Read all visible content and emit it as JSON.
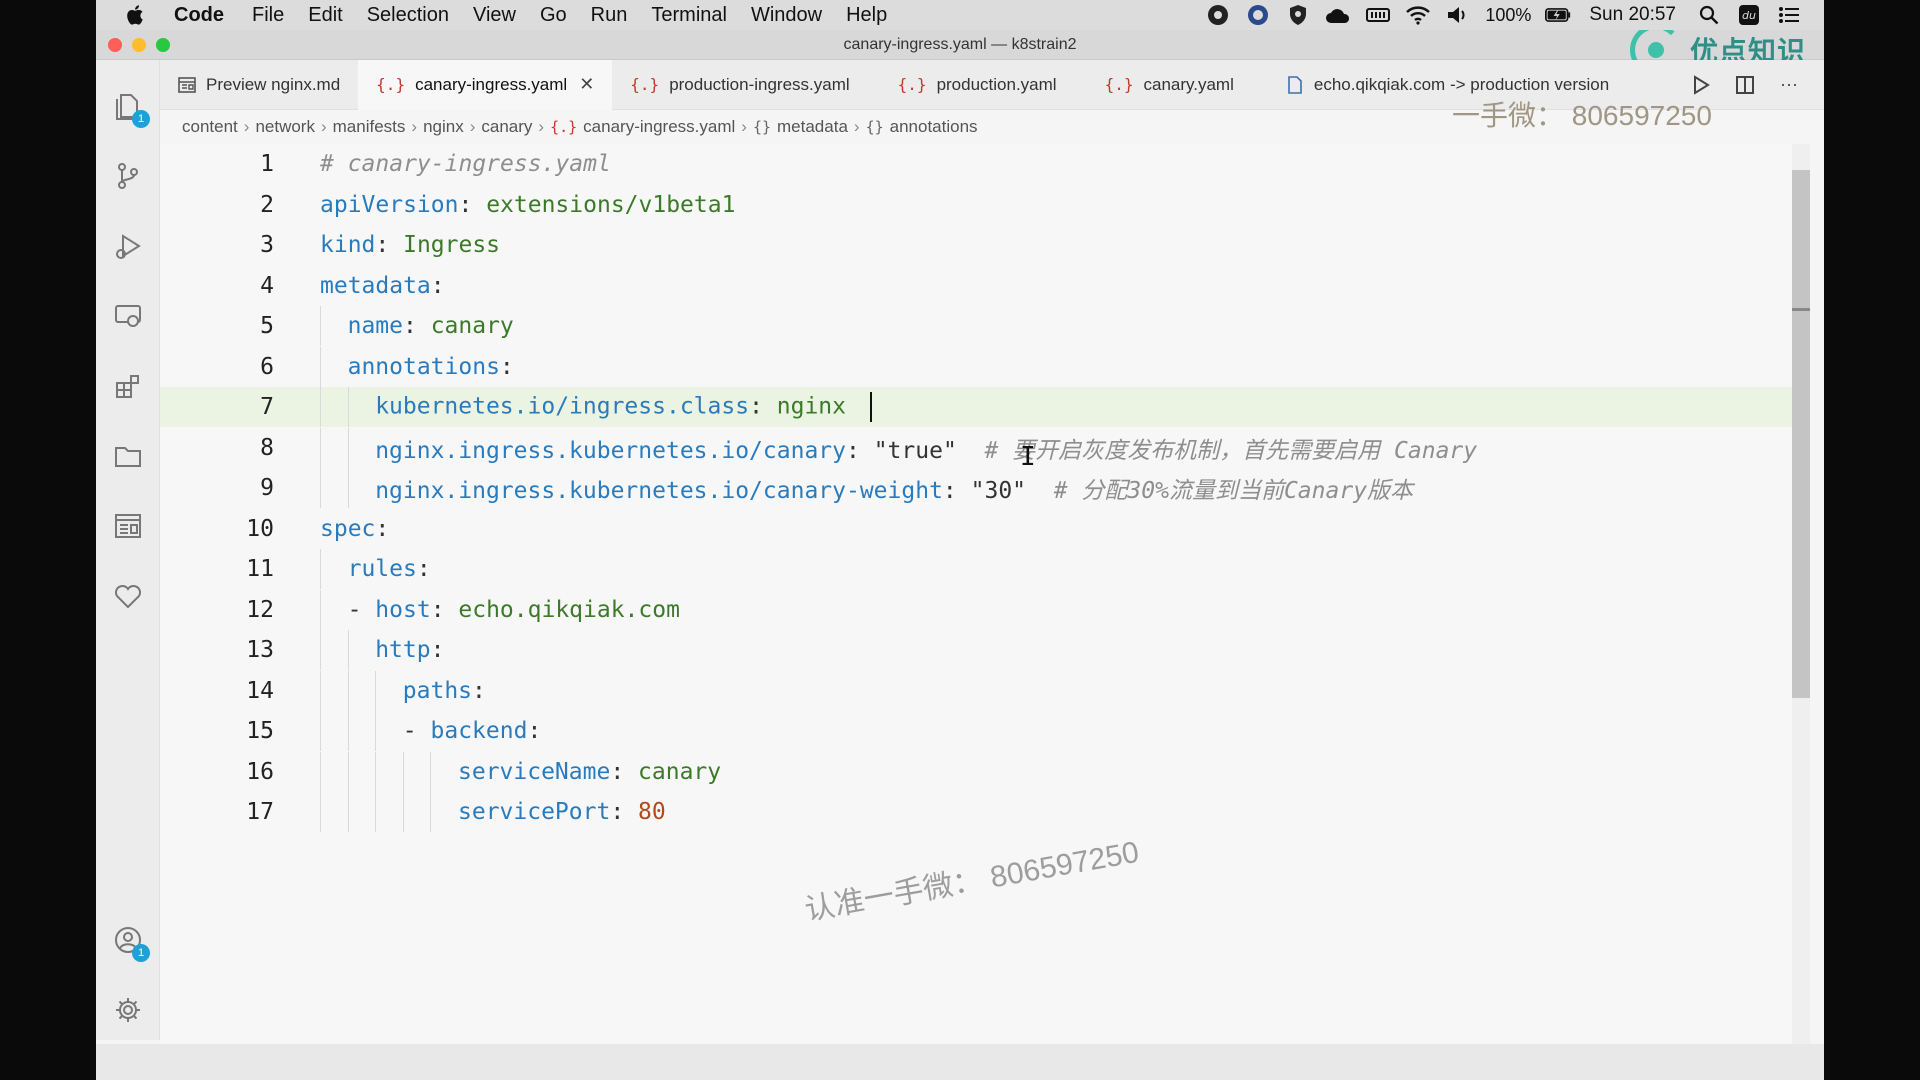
{
  "menubar": {
    "app_name": "Code",
    "items": [
      "File",
      "Edit",
      "Selection",
      "View",
      "Go",
      "Run",
      "Terminal",
      "Window",
      "Help"
    ],
    "battery": "100%",
    "clock": "Sun 20:57"
  },
  "window": {
    "title": "canary-ingress.yaml — k8strain2",
    "brand": "优点知识"
  },
  "activity_badges": {
    "explorer": "1",
    "accounts": "1"
  },
  "tabs": [
    {
      "label": "Preview nginx.md",
      "type": "preview"
    },
    {
      "label": "canary-ingress.yaml",
      "type": "yaml",
      "active": true
    },
    {
      "label": "production-ingress.yaml",
      "type": "yaml"
    },
    {
      "label": "production.yaml",
      "type": "yaml"
    },
    {
      "label": "canary.yaml",
      "type": "yaml"
    },
    {
      "label": "echo.qikqiak.com -> production version",
      "type": "file"
    }
  ],
  "tab_icon_glyph": "{.}",
  "breadcrumb": {
    "items": [
      "content",
      "network",
      "manifests",
      "nginx",
      "canary",
      "canary-ingress.yaml",
      "metadata",
      "annotations"
    ],
    "obj_glyph": "{}"
  },
  "editor": {
    "lines": [
      {
        "n": "1",
        "indent": 0,
        "comment": "# canary-ingress.yaml"
      },
      {
        "n": "2",
        "indent": 0,
        "key": "apiVersion",
        "value": "extensions/v1beta1",
        "vtype": "val"
      },
      {
        "n": "3",
        "indent": 0,
        "key": "kind",
        "value": "Ingress",
        "vtype": "val"
      },
      {
        "n": "4",
        "indent": 0,
        "key": "metadata",
        "value": ""
      },
      {
        "n": "5",
        "indent": 1,
        "key": "name",
        "value": "canary",
        "vtype": "val"
      },
      {
        "n": "6",
        "indent": 1,
        "key": "annotations",
        "value": ""
      },
      {
        "n": "7",
        "indent": 2,
        "key": "kubernetes.io/ingress.class",
        "value": "nginx ",
        "vtype": "val",
        "current": true
      },
      {
        "n": "8",
        "indent": 2,
        "key": "nginx.ingress.kubernetes.io/canary",
        "value": "\"true\"",
        "vtype": "str",
        "trailing": "# 要开启灰度发布机制，首先需要启用 Canary"
      },
      {
        "n": "9",
        "indent": 2,
        "key": "nginx.ingress.kubernetes.io/canary-weight",
        "value": "\"30\"",
        "vtype": "str",
        "trailing": "# 分配30%流量到当前Canary版本"
      },
      {
        "n": "10",
        "indent": 0,
        "key": "spec",
        "value": ""
      },
      {
        "n": "11",
        "indent": 1,
        "key": "rules",
        "value": ""
      },
      {
        "n": "12",
        "indent": 1,
        "dash": true,
        "key": "host",
        "value": "echo.qikqiak.com",
        "vtype": "val"
      },
      {
        "n": "13",
        "indent": 2,
        "key": "http",
        "value": ""
      },
      {
        "n": "14",
        "indent": 3,
        "key": "paths",
        "value": ""
      },
      {
        "n": "15",
        "indent": 3,
        "dash": true,
        "key": "backend",
        "value": ""
      },
      {
        "n": "16",
        "indent": 5,
        "key": "serviceName",
        "value": "canary",
        "vtype": "val"
      },
      {
        "n": "17",
        "indent": 5,
        "key": "servicePort",
        "value": "80",
        "vtype": "num"
      }
    ]
  },
  "watermarks": {
    "contact_top": "一手微： 806597250",
    "contact_center": "认准一手微： 806597250"
  },
  "colors": {
    "key": "#2a7bbd",
    "value": "#3c7a2a",
    "number": "#b34a1b",
    "comment": "#8e8e8e",
    "current_line": "#ebf3e3"
  }
}
